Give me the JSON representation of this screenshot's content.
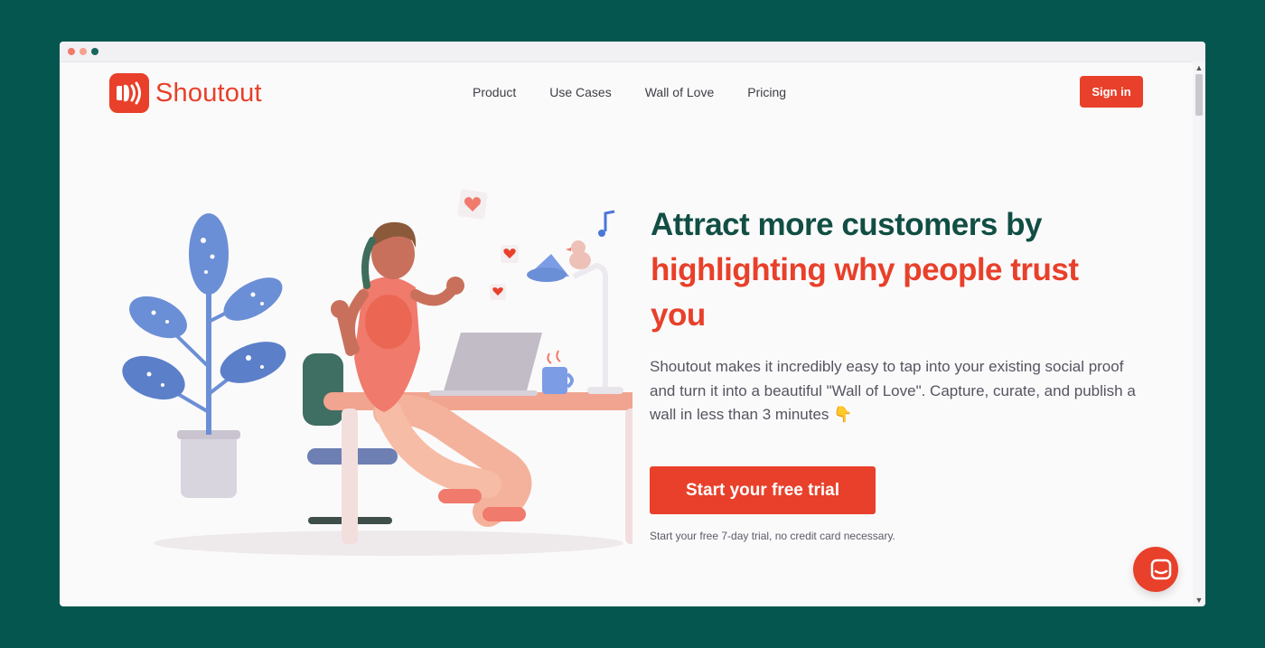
{
  "browser": {
    "controls": [
      "close",
      "minimize",
      "maximize"
    ]
  },
  "brand": {
    "name": "Shoutout",
    "color": "#e8402a",
    "icon": "megaphone-logo-icon"
  },
  "nav": {
    "items": [
      {
        "label": "Product"
      },
      {
        "label": "Use Cases"
      },
      {
        "label": "Wall of Love"
      },
      {
        "label": "Pricing"
      }
    ],
    "signin_label": "Sign in"
  },
  "hero": {
    "headline_part1": "Attract more customers by",
    "headline_part2": "highlighting why people trust you",
    "description": "Shoutout makes it incredibly easy to tap into your existing social proof and turn it into a beautiful \"Wall of Love\". Capture, curate, and publish a wall in less than 3 minutes",
    "description_emoji": "👇",
    "cta_label": "Start your free trial",
    "cta_note": "Start your free 7-day trial, no credit card necessary.",
    "illustration": "woman-at-desk-illustration"
  },
  "colors": {
    "background": "#05564f",
    "headline_dark": "#114e44",
    "accent": "#e8402a"
  },
  "chat": {
    "icon": "chat-bubble-icon"
  }
}
